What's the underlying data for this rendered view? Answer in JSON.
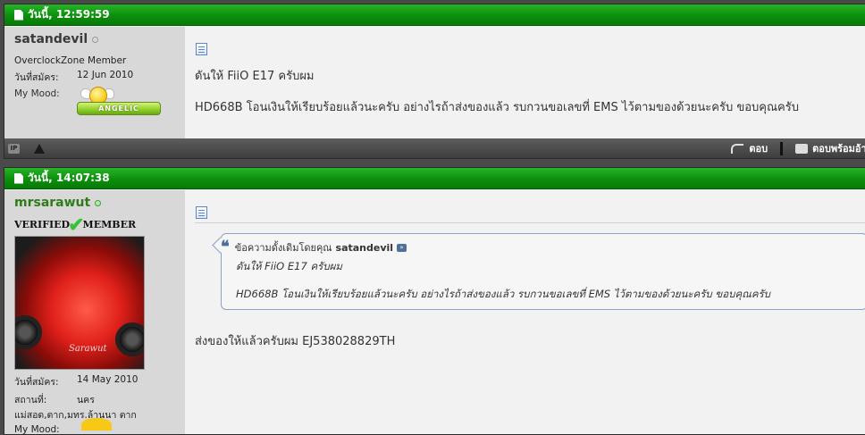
{
  "posts": [
    {
      "date": "วันนี้, 12:59:59",
      "user": {
        "name": "satandevil",
        "title": "OverclockZone Member",
        "join_label": "วันที่สมัคร:",
        "join_date": "12 Jun 2010",
        "mood_label": "My Mood:",
        "mood_text": "ANGELIC"
      },
      "message": {
        "line1": "ดันให้ FiiO E17 ครับผม",
        "line2": "HD668B โอนเงินให้เรียบร้อยแล้วนะครับ อย่างไรถ้าส่งของแล้ว รบกวนขอเลขที่ EMS ไว้ตามของด้วยนะครับ ขอบคุณครับ"
      },
      "footer": {
        "ip_label": "IP",
        "reply_label": "ตอบ",
        "quote_reply_label": "ตอบพร้อมอ้าง"
      }
    },
    {
      "date": "วันนี้, 14:07:38",
      "user": {
        "name": "mrsarawut",
        "verified_left": "VERIFIED",
        "verified_right": "MEMBER",
        "avatar_signature": "Sarawut",
        "join_label": "วันที่สมัคร:",
        "join_date": "14 May 2010",
        "location_label": "สถานที่:",
        "location_value": "นคร",
        "location_line2": "แม่สอด,ตาก,มทร.ล้านนา ตาก",
        "mood_label": "My Mood:"
      },
      "quote": {
        "prefix": "ข้อความดั้งเดิมโดยคุณ",
        "author": "satandevil",
        "line1": "ดันให้ FiiO E17 ครับผม",
        "line2": "HD668B โอนเงินให้เรียบร้อยแล้วนะครับ อย่างไรถ้าส่งของแล้ว รบกวนขอเลขที่ EMS ไว้ตามของด้วยนะครับ ขอบคุณครับ"
      },
      "message": {
        "line1": "ส่งของให้แล้วครับผม EJ538028829TH"
      }
    }
  ]
}
